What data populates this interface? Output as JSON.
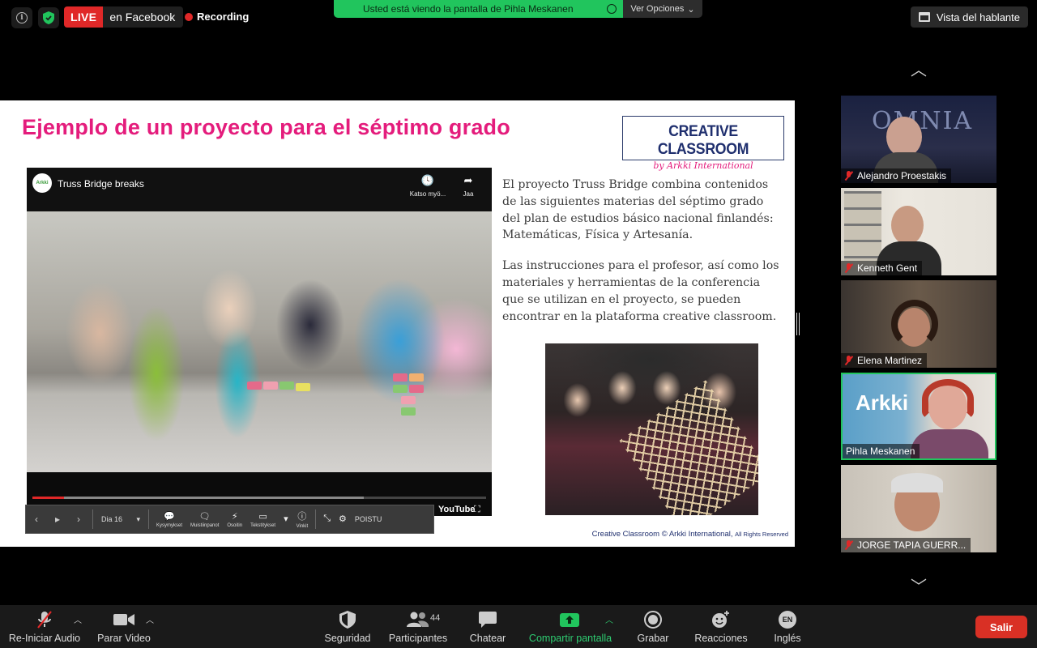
{
  "topbar": {
    "live_badge": "LIVE",
    "live_platform": "en Facebook",
    "recording": "Recording",
    "viewing_banner": "Usted está viendo la pantalla de Pihla Meskanen",
    "view_options": "Ver Opciones",
    "speaker_view": "Vista del hablante"
  },
  "slide": {
    "title": "Ejemplo de un proyecto para el séptimo grado",
    "logo_line1": "CREATIVE CLASSROOM",
    "logo_line2": "by Arkki International",
    "paragraph1": "El proyecto Truss Bridge combina contenidos de las siguientes materias del séptimo grado del plan de estudios básico nacional finlandés: Matemáticas, Física y Artesanía.",
    "paragraph2": "Las instrucciones para el profesor, así como los materiales y herramientas de la conferencia que se utilizan en el proyecto, se pueden encontrar en la plataforma creative classroom.",
    "footer": "Creative Classroom © Arkki International,",
    "footer_small": "All Rights Reserved",
    "video": {
      "channel_logo": "Arkki",
      "title": "Truss Bridge breaks",
      "watch_later": "Katso myö...",
      "share": "Jaa",
      "youtube": "YouTube",
      "progress": 0.07,
      "buffered": 0.73
    }
  },
  "presenter_controls": {
    "slide_label": "Dia 16",
    "items": [
      {
        "icon": "questions-icon",
        "label": "Kysymykset"
      },
      {
        "icon": "notes-icon",
        "label": "Muistiinpanot"
      },
      {
        "icon": "laser-pointer-icon",
        "label": "Osoitin"
      },
      {
        "icon": "subtitles-icon",
        "label": "Tekstitykset"
      },
      {
        "icon": "tips-icon",
        "label": "Vinkit"
      }
    ],
    "exit": "POISTU"
  },
  "participants_gallery": [
    {
      "name": "Alejandro Proestakis",
      "muted": true
    },
    {
      "name": "Kenneth Gent",
      "muted": true
    },
    {
      "name": "Elena Martinez",
      "muted": true
    },
    {
      "name": "Pihla Meskanen",
      "muted": false
    },
    {
      "name": "JORGE TAPIA GUERR...",
      "muted": true
    }
  ],
  "toolbar": {
    "audio": "Re-Iniciar Audio",
    "video": "Parar Video",
    "security": "Seguridad",
    "participants": "Participantes",
    "participants_count": "44",
    "chat": "Chatear",
    "share": "Compartir pantalla",
    "record": "Grabar",
    "reactions": "Reacciones",
    "language_code": "EN",
    "language": "Inglés",
    "end": "Salir"
  },
  "colors": {
    "accent_green": "#21c55d",
    "live_red": "#e02828",
    "title_pink": "#e41c7c",
    "brand_navy": "#1f2f6e"
  }
}
